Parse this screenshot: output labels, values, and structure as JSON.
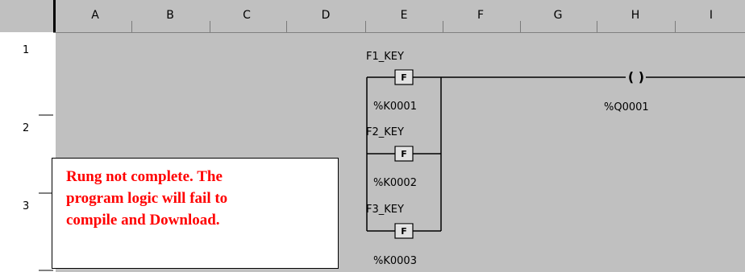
{
  "columns": [
    "A",
    "B",
    "C",
    "D",
    "E",
    "F",
    "G",
    "H",
    "I"
  ],
  "rows": [
    "1",
    "2",
    "3"
  ],
  "contacts": [
    {
      "tag": "F1_KEY",
      "address": "%K0001",
      "symbol": "F"
    },
    {
      "tag": "F2_KEY",
      "address": "%K0002",
      "symbol": "F"
    },
    {
      "tag": "F3_KEY",
      "address": "%K0003",
      "symbol": "F"
    }
  ],
  "coil": {
    "symbol": "( )",
    "address": "%Q0001"
  },
  "note": {
    "text": "Rung not complete.  The\nprogram logic will fail to\ncompile and Download."
  },
  "colors": {
    "grid_bg": "#c0c0c0",
    "note_text": "#ff0000"
  }
}
